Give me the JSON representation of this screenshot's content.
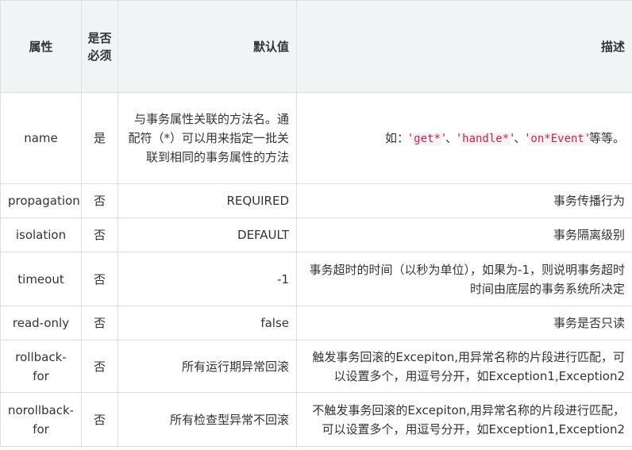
{
  "table": {
    "headers": [
      "属性",
      "是否必须",
      "默认值",
      "描述"
    ],
    "rows": [
      {
        "attr": "name",
        "required": "是",
        "default": "与事务属性关联的方法名。通配符（*）可以用来指定一批关联到相同的事务属性的方法",
        "desc": {
          "prefix": "如：",
          "codes": [
            "get*",
            "handle*",
            "on*Event"
          ],
          "sep": "、",
          "suffix": "等等。"
        }
      },
      {
        "attr": "propagation",
        "required": "否",
        "default": "REQUIRED",
        "desc": "事务传播行为"
      },
      {
        "attr": "isolation",
        "required": "否",
        "default": "DEFAULT",
        "desc": "事务隔离级别"
      },
      {
        "attr": "timeout",
        "required": "否",
        "default": "-1",
        "desc": "事务超时的时间（以秒为单位），如果为-1，则说明事务超时时间由底层的事务系统所决定"
      },
      {
        "attr": "read-only",
        "required": "否",
        "default": "false",
        "desc": "事务是否只读"
      },
      {
        "attr": "rollback-for",
        "required": "否",
        "default": "所有运行期异常回滚",
        "desc": "触发事务回滚的Excepiton,用异常名称的片段进行匹配，可以设置多个，用逗号分开，如Exception1,Exception2"
      },
      {
        "attr": "norollback-for",
        "required": "否",
        "default": "所有检查型异常不回滚",
        "desc": "不触发事务回滚的Excepiton,用异常名称的片段进行匹配，可以设置多个，用逗号分开，如Exception1,Exception2"
      }
    ]
  }
}
